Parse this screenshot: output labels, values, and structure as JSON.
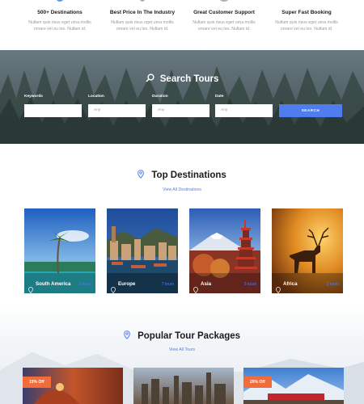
{
  "features": [
    {
      "title": "500+ Destinations",
      "text": "Nullam quis risus eget urna mollis ornare vel eu leo. Nullam id."
    },
    {
      "title": "Best Price In The Industry",
      "text": "Nullam quis risus eget urna mollis ornare vel eu leo. Nullam id."
    },
    {
      "title": "Great Customer Support",
      "text": "Nullam quis risus eget urna mollis ornare vel eu leo. Nullam id."
    },
    {
      "title": "Super Fast Booking",
      "text": "Nullam quis risus eget urna mollis ornare vel eu leo. Nullam id."
    }
  ],
  "search": {
    "title": "Search Tours",
    "keywords_label": "Keywords",
    "location_label": "Location",
    "duration_label": "Duration",
    "date_label": "Date",
    "location_value": "Any",
    "duration_value": "Any",
    "date_value": "Any",
    "button_label": "SEARCH"
  },
  "destinations": {
    "title": "Top Destinations",
    "view_all": "View All Destinations",
    "items": [
      {
        "name": "South America",
        "tours": "3 tours"
      },
      {
        "name": "Europe",
        "tours": "7 tours"
      },
      {
        "name": "Asia",
        "tours": "5 tours"
      },
      {
        "name": "Africa",
        "tours": "3 tours"
      }
    ]
  },
  "packages": {
    "title": "Popular Tour Packages",
    "view_all": "View All Tours",
    "badges": [
      "15% Off",
      "20% Off"
    ]
  },
  "colors": {
    "accent": "#4f7df0",
    "badge": "#f26b3a"
  },
  "icons": {
    "search": "search-icon",
    "pin": "map-pin-icon"
  }
}
